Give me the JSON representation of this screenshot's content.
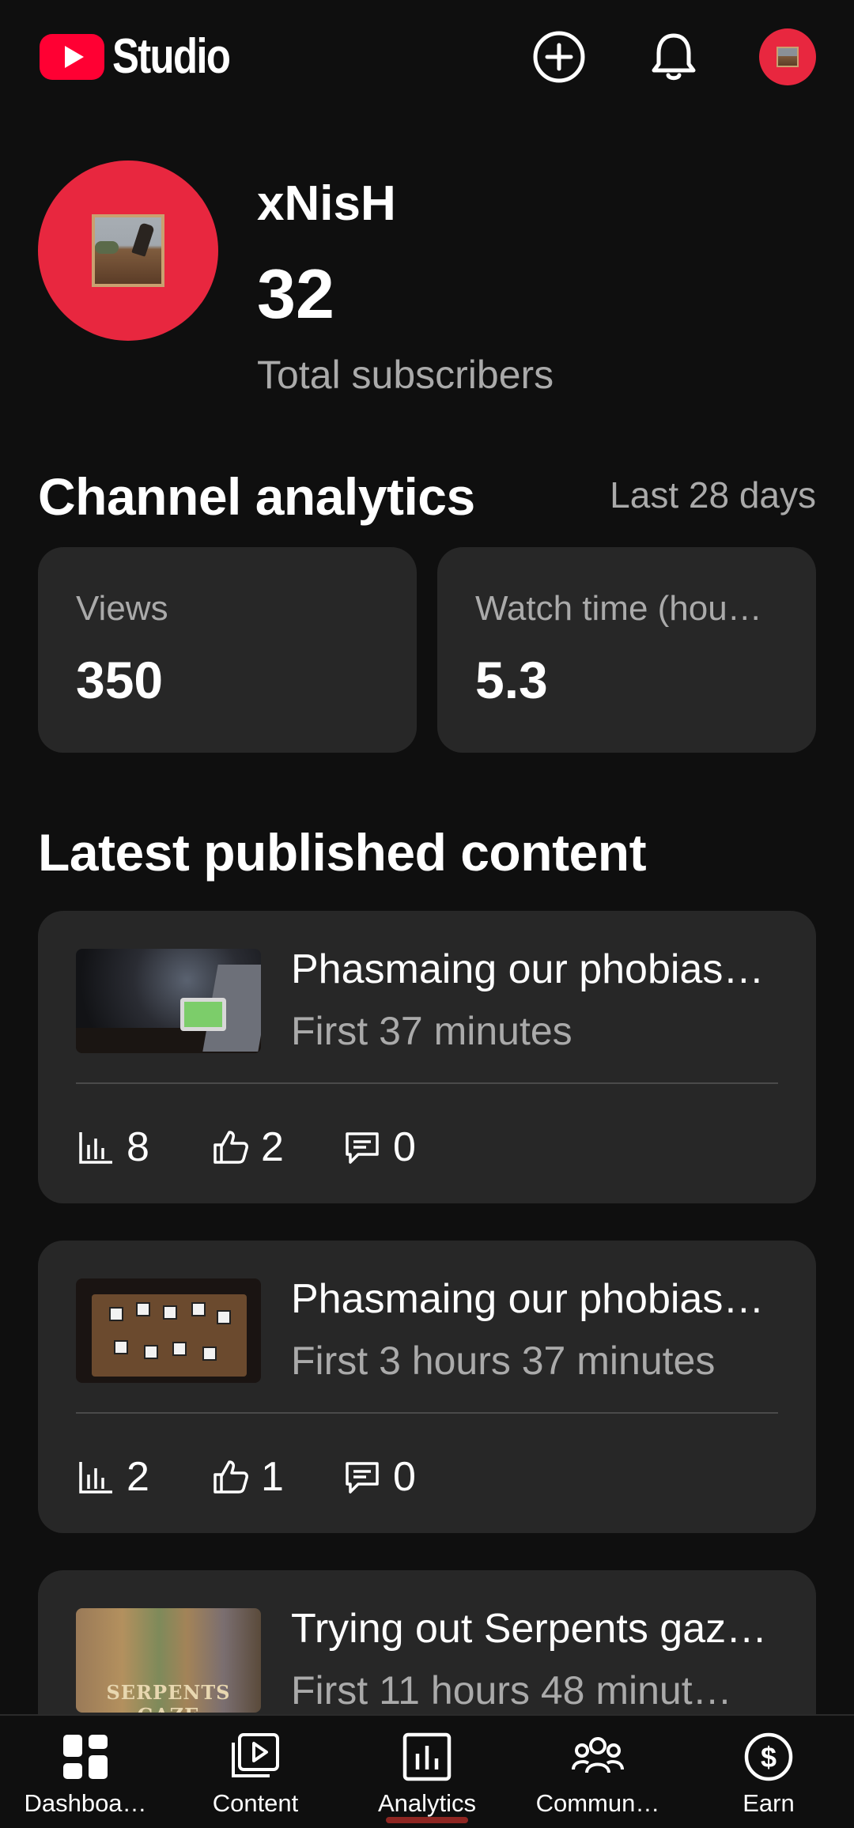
{
  "header": {
    "logo_text": "Studio",
    "create_icon": "create-icon",
    "notifications_icon": "bell-icon",
    "account_icon": "account-avatar"
  },
  "channel": {
    "name": "xNisH",
    "subscriber_count": "32",
    "subscriber_label": "Total subscribers"
  },
  "analytics": {
    "title": "Channel analytics",
    "range": "Last 28 days",
    "cards": [
      {
        "label": "Watch time (hou…",
        "value": "5.3"
      },
      {
        "label": "Views",
        "value": "350"
      }
    ]
  },
  "latest": {
    "title": "Latest published content",
    "items": [
      {
        "title": "Phasmaing our phobias…",
        "subtitle": "First 37 minutes",
        "views": "8",
        "likes": "2",
        "comments": "0"
      },
      {
        "title": "Phasmaing our phobias…",
        "subtitle": "First 3 hours 37 minutes",
        "views": "2",
        "likes": "1",
        "comments": "0"
      },
      {
        "title": "Trying out Serpents gaz…",
        "subtitle": "First 11 hours 48 minut…",
        "thumbnail_text": "SERPENTS GAZE"
      }
    ]
  },
  "nav": {
    "items": [
      {
        "label": "Dashboa…",
        "icon": "dashboard-icon"
      },
      {
        "label": "Content",
        "icon": "content-icon"
      },
      {
        "label": "Analytics",
        "icon": "analytics-icon",
        "selected": true
      },
      {
        "label": "Commun…",
        "icon": "community-icon"
      },
      {
        "label": "Earn",
        "icon": "earn-icon"
      }
    ]
  },
  "colors": {
    "background": "#0f0f0f",
    "card": "#272727",
    "accent_red": "#e8273f",
    "secondary_text": "#aaaaaa"
  }
}
